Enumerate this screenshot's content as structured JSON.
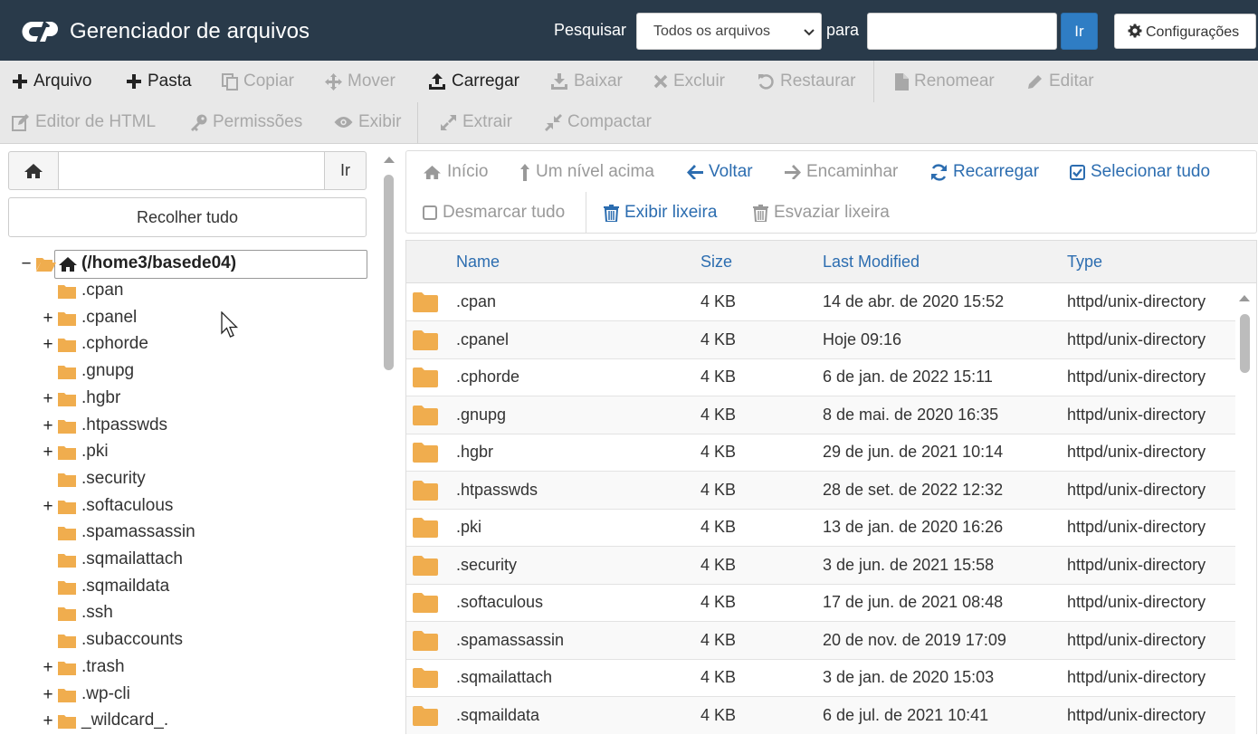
{
  "header": {
    "app_title": "Gerenciador de arquivos",
    "search_label": "Pesquisar",
    "search_scope_selected": "Todos os arquivos",
    "para_label": "para",
    "search_value": "",
    "go_label": "Ir",
    "settings_label": "Configurações",
    "colors": {
      "header_bg": "#293a4a",
      "accent": "#2f7dc4"
    }
  },
  "toolbar": {
    "file": "Arquivo",
    "folder": "Pasta",
    "copy": "Copiar",
    "move": "Mover",
    "upload": "Carregar",
    "download": "Baixar",
    "delete": "Excluir",
    "restore": "Restaurar",
    "rename": "Renomear",
    "edit": "Editar",
    "html_editor": "Editor de HTML",
    "permissions": "Permissões",
    "view": "Exibir",
    "extract": "Extrair",
    "compress": "Compactar"
  },
  "left_panel": {
    "path_value": "",
    "go_label": "Ir",
    "collapse_all": "Recolher tudo",
    "root_label": "(/home3/basede04)",
    "root_expander": "−",
    "tree": [
      {
        "label": ".cpan",
        "expander": ""
      },
      {
        "label": ".cpanel",
        "expander": "+"
      },
      {
        "label": ".cphorde",
        "expander": "+"
      },
      {
        "label": ".gnupg",
        "expander": ""
      },
      {
        "label": ".hgbr",
        "expander": "+"
      },
      {
        "label": ".htpasswds",
        "expander": "+"
      },
      {
        "label": ".pki",
        "expander": "+"
      },
      {
        "label": ".security",
        "expander": ""
      },
      {
        "label": ".softaculous",
        "expander": "+"
      },
      {
        "label": ".spamassassin",
        "expander": ""
      },
      {
        "label": ".sqmailattach",
        "expander": ""
      },
      {
        "label": ".sqmaildata",
        "expander": ""
      },
      {
        "label": ".ssh",
        "expander": ""
      },
      {
        "label": ".subaccounts",
        "expander": ""
      },
      {
        "label": ".trash",
        "expander": "+"
      },
      {
        "label": ".wp-cli",
        "expander": "+"
      },
      {
        "label": "_wildcard_.",
        "expander": "+"
      }
    ]
  },
  "nav": {
    "home": "Início",
    "up_one_level": "Um nível acima",
    "back": "Voltar",
    "forward": "Encaminhar",
    "reload": "Recarregar",
    "select_all": "Selecionar tudo",
    "unselect_all": "Desmarcar tudo",
    "view_trash": "Exibir lixeira",
    "empty_trash": "Esvaziar lixeira"
  },
  "table": {
    "columns": [
      "Name",
      "Size",
      "Last Modified",
      "Type"
    ],
    "rows": [
      {
        "name": ".cpan",
        "size": "4 KB",
        "modified": "14 de abr. de 2020 15:52",
        "type": "httpd/unix-directory"
      },
      {
        "name": ".cpanel",
        "size": "4 KB",
        "modified": "Hoje 09:16",
        "type": "httpd/unix-directory"
      },
      {
        "name": ".cphorde",
        "size": "4 KB",
        "modified": "6 de jan. de 2022 15:11",
        "type": "httpd/unix-directory"
      },
      {
        "name": ".gnupg",
        "size": "4 KB",
        "modified": "8 de mai. de 2020 16:35",
        "type": "httpd/unix-directory"
      },
      {
        "name": ".hgbr",
        "size": "4 KB",
        "modified": "29 de jun. de 2021 10:14",
        "type": "httpd/unix-directory"
      },
      {
        "name": ".htpasswds",
        "size": "4 KB",
        "modified": "28 de set. de 2022 12:32",
        "type": "httpd/unix-directory"
      },
      {
        "name": ".pki",
        "size": "4 KB",
        "modified": "13 de jan. de 2020 16:26",
        "type": "httpd/unix-directory"
      },
      {
        "name": ".security",
        "size": "4 KB",
        "modified": "3 de jun. de 2021 15:58",
        "type": "httpd/unix-directory"
      },
      {
        "name": ".softaculous",
        "size": "4 KB",
        "modified": "17 de jun. de 2021 08:48",
        "type": "httpd/unix-directory"
      },
      {
        "name": ".spamassassin",
        "size": "4 KB",
        "modified": "20 de nov. de 2019 17:09",
        "type": "httpd/unix-directory"
      },
      {
        "name": ".sqmailattach",
        "size": "4 KB",
        "modified": "3 de jan. de 2020 15:03",
        "type": "httpd/unix-directory"
      },
      {
        "name": ".sqmaildata",
        "size": "4 KB",
        "modified": "6 de jul. de 2021 10:41",
        "type": "httpd/unix-directory"
      }
    ]
  },
  "icons": {
    "folder_color": "#f0ad4e",
    "link_color": "#2c6db0",
    "disabled_color": "#a8a8a8"
  }
}
